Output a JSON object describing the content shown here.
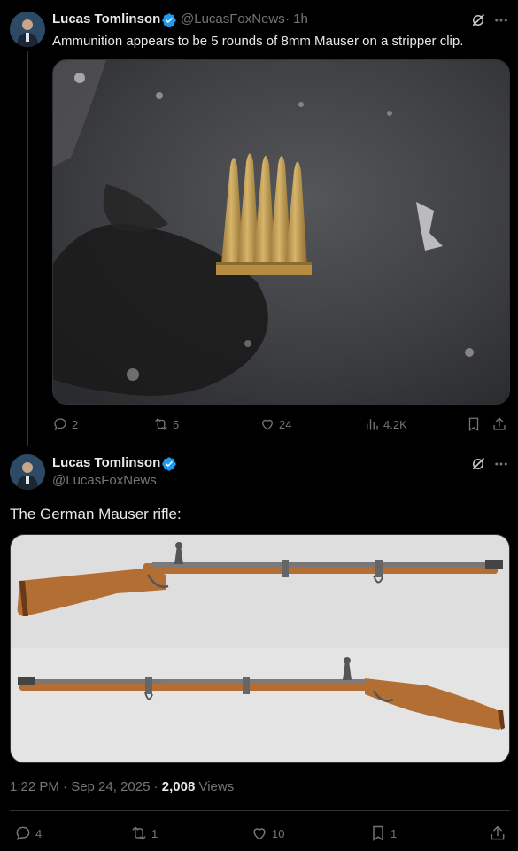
{
  "post1": {
    "author_name": "Lucas Tomlinson",
    "author_handle": "@LucasFoxNews",
    "time": "· 1h",
    "text": "Ammunition appears to be 5 rounds of 8mm Mauser on a stripper clip.",
    "stats": {
      "replies": "2",
      "reposts": "5",
      "likes": "24",
      "views": "4.2K"
    }
  },
  "post2": {
    "author_name": "Lucas Tomlinson",
    "author_handle": "@LucasFoxNews",
    "text": "The German Mauser rifle:",
    "timestamp": "1:22 PM · Sep 24, 2025 · ",
    "views_count": "2,008",
    "views_label": " Views",
    "stats": {
      "replies": "4",
      "reposts": "1",
      "likes": "10",
      "bookmarks": "1"
    }
  },
  "icons": {
    "verified": "verified-badge-icon",
    "grok": "grok-icon",
    "more": "more-icon",
    "reply": "reply-icon",
    "repost": "repost-icon",
    "like": "like-icon",
    "views": "views-icon",
    "bookmark": "bookmark-icon",
    "share": "share-icon"
  },
  "colors": {
    "background": "#000000",
    "text": "#e7e9ea",
    "muted": "#71767b",
    "verified": "#1d9bf0",
    "divider": "#2f3336"
  }
}
